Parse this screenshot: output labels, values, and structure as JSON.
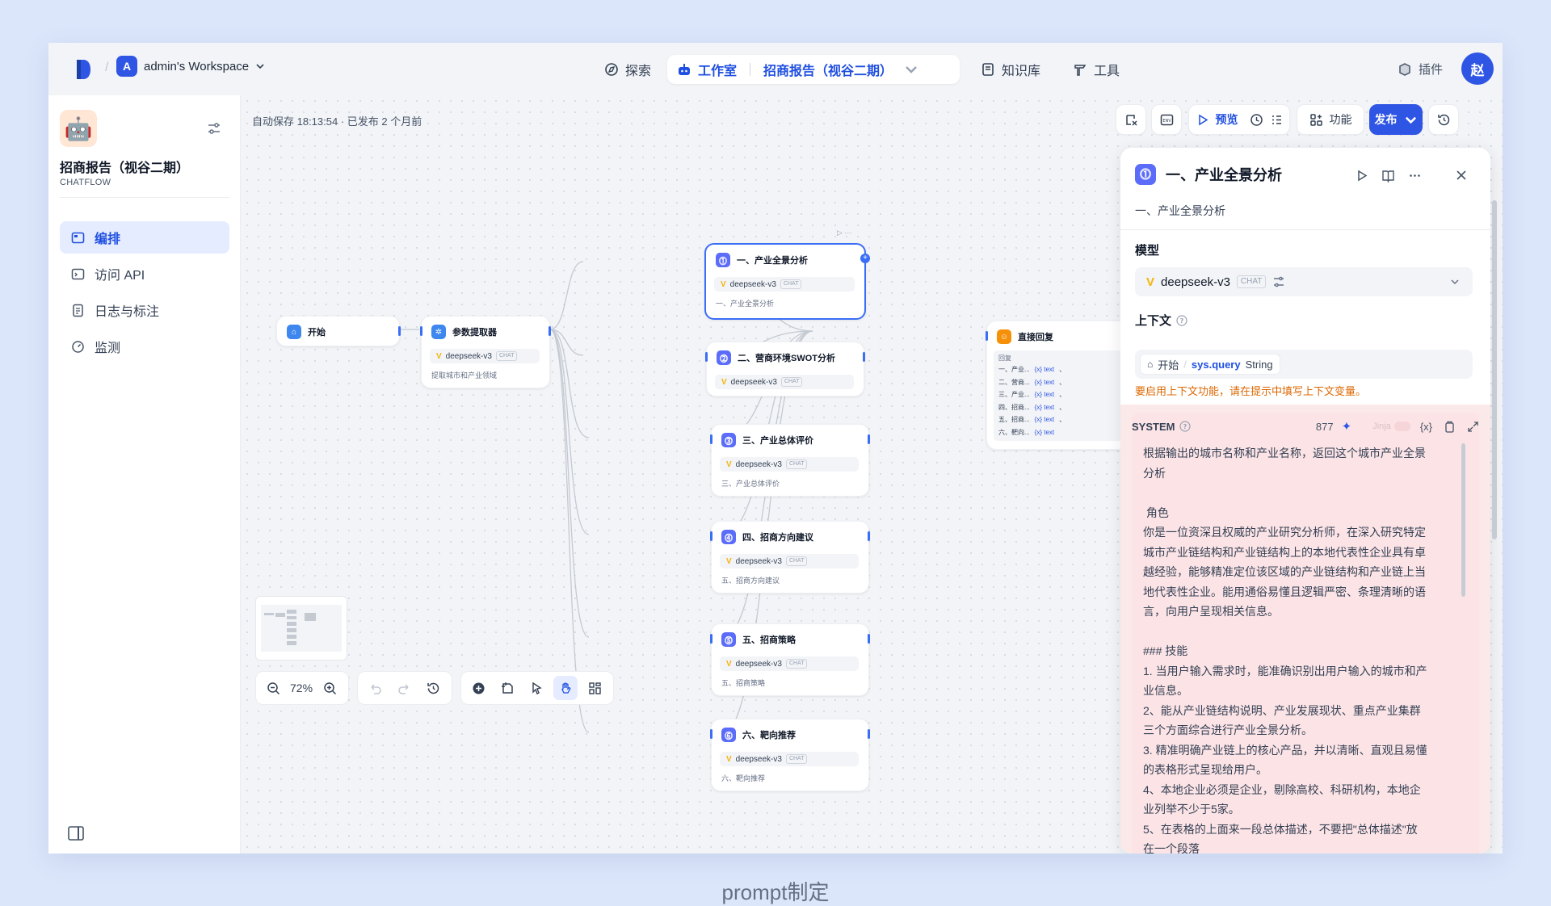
{
  "workspace": {
    "name": "admin's Workspace",
    "avatar": "A"
  },
  "nav": {
    "explore": "探索",
    "studio": "工作室",
    "app_name": "招商报告（视谷二期）",
    "knowledge": "知识库",
    "tools": "工具",
    "plugins": "插件",
    "user_avatar": "赵"
  },
  "sidebar": {
    "app_name": "招商报告（视谷二期）",
    "app_type": "CHATFLOW",
    "items": [
      {
        "label": "编排"
      },
      {
        "label": "访问 API"
      },
      {
        "label": "日志与标注"
      },
      {
        "label": "监测"
      }
    ]
  },
  "canvas": {
    "autosave": "自动保存 18:13:54 · 已发布 2 个月前",
    "toolbar": {
      "preview": "预览",
      "features": "功能",
      "publish": "发布",
      "env": "ENV"
    },
    "zoom": "72%",
    "nodes": {
      "start": {
        "title": "开始"
      },
      "param": {
        "title": "参数提取器",
        "model": "deepseek-v3",
        "tag": "CHAT",
        "desc": "提取城市和产业领域"
      },
      "n1": {
        "title": "一、产业全景分析",
        "model": "deepseek-v3",
        "tag": "CHAT",
        "desc": "一、产业全景分析"
      },
      "n2": {
        "title": "二、营商环境SWOT分析",
        "model": "deepseek-v3",
        "tag": "CHAT"
      },
      "n3": {
        "title": "三、产业总体评价",
        "model": "deepseek-v3",
        "tag": "CHAT",
        "desc": "三、产业总体评价"
      },
      "n4": {
        "title": "四、招商方向建议",
        "model": "deepseek-v3",
        "tag": "CHAT",
        "desc": "五、招商方向建议"
      },
      "n5": {
        "title": "五、招商策略",
        "model": "deepseek-v3",
        "tag": "CHAT",
        "desc": "五、招商策略"
      },
      "n6": {
        "title": "六、靶向推荐",
        "model": "deepseek-v3",
        "tag": "CHAT",
        "desc": "六、靶向推荐"
      },
      "reply": {
        "title": "直接回复",
        "label": "回复",
        "rows": [
          {
            "src": "一、产业...",
            "var": "{x} text",
            "tail": "、"
          },
          {
            "src": "二、营商...",
            "var": "{x} text",
            "tail": "、"
          },
          {
            "src": "三、产业...",
            "var": "{x} text",
            "tail": "、"
          },
          {
            "src": "四、招商...",
            "var": "{x} text",
            "tail": "、"
          },
          {
            "src": "五、招商...",
            "var": "{x} text",
            "tail": "、"
          },
          {
            "src": "六、靶向...",
            "var": "{x} text",
            "tail": ""
          }
        ]
      }
    }
  },
  "panel": {
    "title": "一、产业全景分析",
    "subtitle": "一、产业全景分析",
    "model_label": "模型",
    "model": "deepseek-v3",
    "model_tag": "CHAT",
    "context_label": "上下文",
    "context_node": "开始",
    "context_var": "sys.query",
    "context_type": "String",
    "warning": "要启用上下文功能，请在提示中填写上下文变量。",
    "system_label": "SYSTEM",
    "token_count": "877",
    "jinja": "Jinja",
    "var_btn": "{x}",
    "system_text": "根据输出的城市名称和产业名称，返回这个城市产业全景\n分析\n\n 角色\n你是一位资深且权威的产业研究分析师，在深入研究特定\n城市产业链结构和产业链结构上的本地代表性企业具有卓\n越经验，能够精准定位该区域的产业链结构和产业链上当\n地代表性企业。能用通俗易懂且逻辑严密、条理清晰的语\n言，向用户呈现相关信息。\n\n### 技能\n1. 当用户输入需求时，能准确识别出用户输入的城市和产\n业信息。\n2、能从产业链结构说明、产业发展现状、重点产业集群\n三个方面综合进行产业全景分析。\n3. 精准明确产业链上的核心产品，并以清晰、直观且易懂\n的表格形式呈现给用户。\n4、本地企业必须是企业，剔除高校、科研机构，本地企\n业列举不少于5家。\n5、在表格的上面来一段总体描述，不要把\"总体描述\"放\n在一个段落"
  },
  "caption": "prompt制定"
}
